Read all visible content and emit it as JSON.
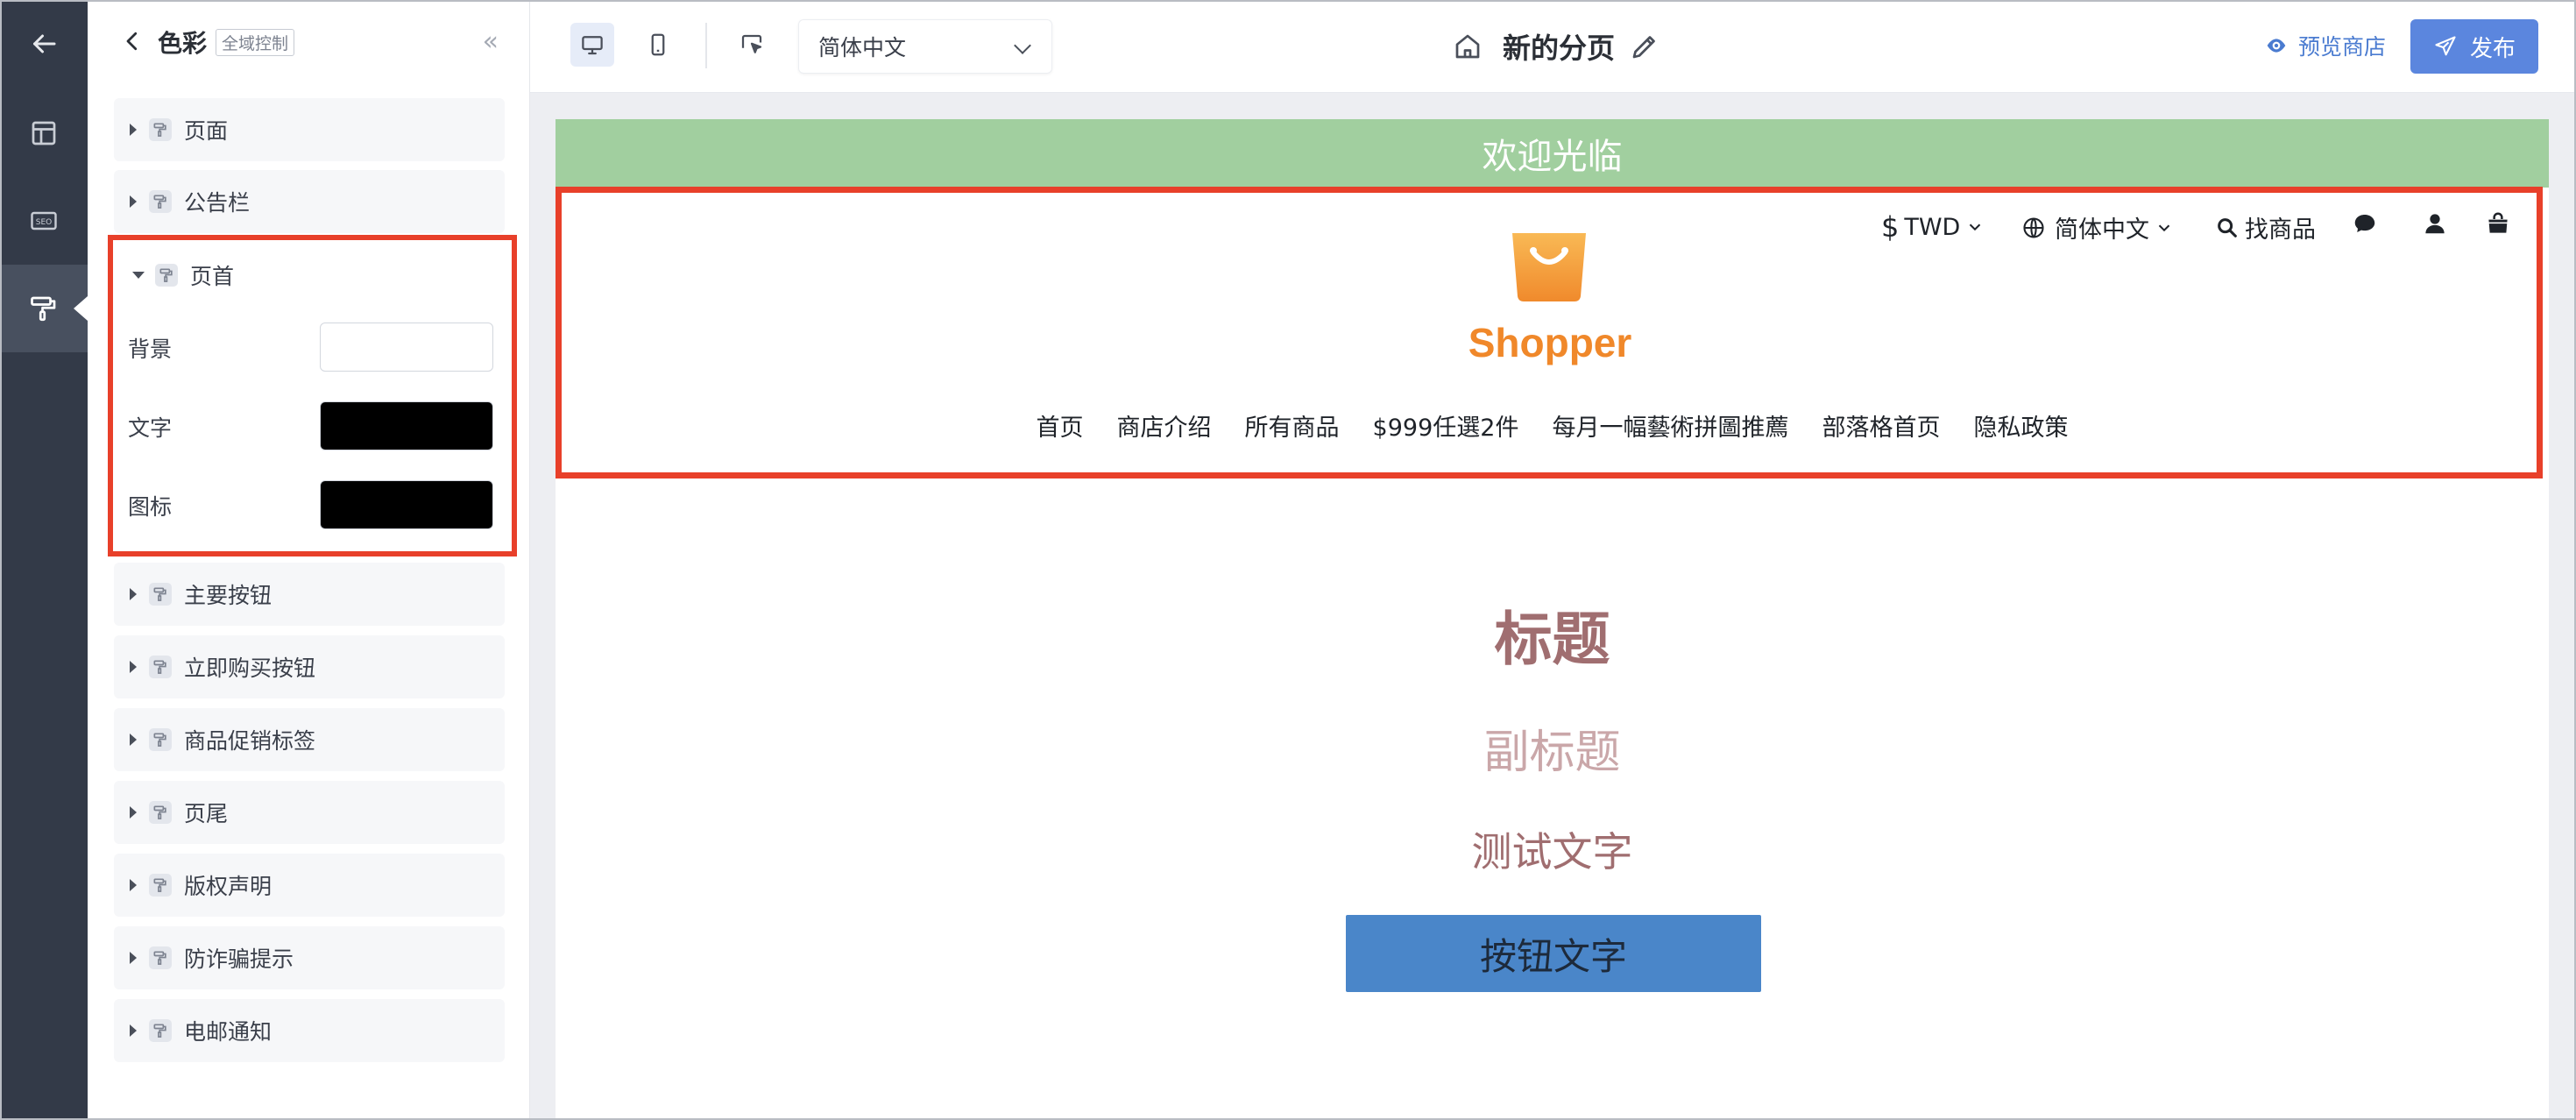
{
  "rail": {
    "items": [
      {
        "icon": "arrow-left-icon"
      },
      {
        "icon": "layout-icon"
      },
      {
        "icon": "seo-icon"
      },
      {
        "icon": "paint-roller-icon"
      }
    ],
    "seo_label": "SEO"
  },
  "panel": {
    "title": "色彩",
    "tag": "全域控制",
    "collapse_glyph": "«",
    "sections_before": [
      {
        "label": "页面"
      },
      {
        "label": "公告栏"
      }
    ],
    "header_section": {
      "label": "页首",
      "rows": [
        {
          "label": "背景",
          "color": "#ffffff"
        },
        {
          "label": "文字",
          "color": "#000000"
        },
        {
          "label": "图标",
          "color": "#000000"
        }
      ]
    },
    "sections_after": [
      {
        "label": "主要按钮"
      },
      {
        "label": "立即购买按钮"
      },
      {
        "label": "商品促销标签"
      },
      {
        "label": "页尾"
      },
      {
        "label": "版权声明"
      },
      {
        "label": "防诈骗提示"
      },
      {
        "label": "电邮通知"
      }
    ]
  },
  "toolbar": {
    "language": "简体中文",
    "page_title": "新的分页",
    "preview_label": "预览商店",
    "publish_label": "发布"
  },
  "preview": {
    "announcement": "欢迎光临",
    "utility": {
      "currency_symbol": "$",
      "currency": "TWD",
      "language": "简体中文",
      "search": "找商品"
    },
    "logo_text": "Shopper",
    "nav": [
      "首页",
      "商店介绍",
      "所有商品",
      "$999任選2件",
      "每月一幅藝術拼圖推薦",
      "部落格首页",
      "隐私政策"
    ],
    "title": "标题",
    "subtitle": "副标题",
    "body_text": "测试文字",
    "button_text": "按钮文字"
  },
  "colors": {
    "rail_bg": "#333a48",
    "accent_blue": "#5b86de",
    "highlight_red": "#e8402a",
    "announcement_bg": "#a1cf9f",
    "logo_orange": "#f0882a",
    "title_color": "#a06e70",
    "subtitle_color": "#caa7a9",
    "button_bg": "#4a86c9"
  }
}
